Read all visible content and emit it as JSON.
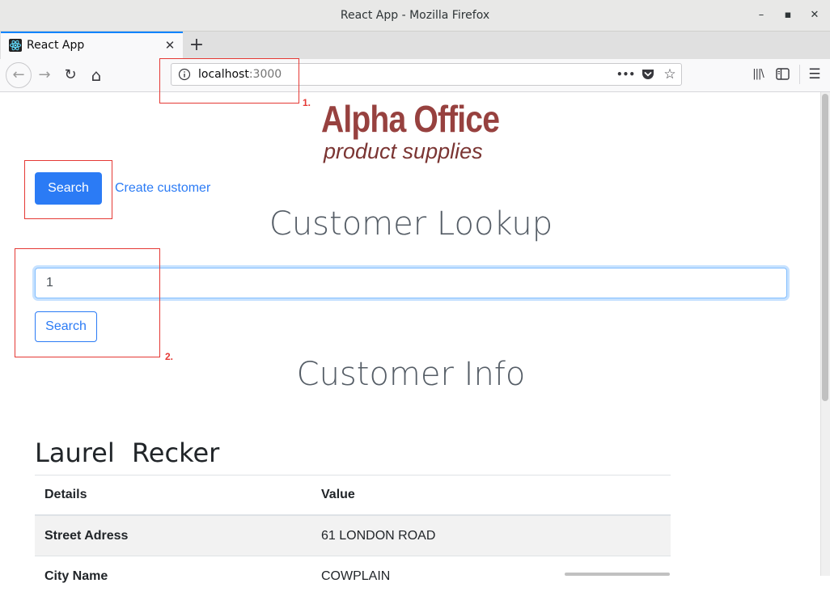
{
  "window": {
    "title": "React App - Mozilla Firefox",
    "controls": {
      "minimize": "–",
      "maximize": "▪",
      "close": "✕"
    }
  },
  "tabs": [
    {
      "title": "React App",
      "icon": "react-logo-icon",
      "active": true
    }
  ],
  "toolbar": {
    "new_tab": "+",
    "back": "←",
    "forward": "→",
    "reload": "↻",
    "home": "⌂",
    "page_actions": "•••",
    "library": "|||\\",
    "sidebar": "▥",
    "menu": "☰"
  },
  "url": {
    "host": "localhost",
    "port": ":3000"
  },
  "annotations": [
    {
      "label": "1."
    },
    {
      "label": "2."
    }
  ],
  "page": {
    "logo": {
      "line1": "Alpha Office",
      "line2": "product supplies"
    },
    "nav": {
      "search_label": "Search",
      "create_label": "Create customer"
    },
    "lookup": {
      "heading": "Customer Lookup",
      "input_value": "1",
      "button_label": "Search"
    },
    "info": {
      "heading": "Customer Info",
      "first_name": "Laurel",
      "last_name": "Recker",
      "table": {
        "headers": [
          "Details",
          "Value"
        ],
        "rows": [
          {
            "key": "Street Adress",
            "value": "61 LONDON ROAD"
          },
          {
            "key": "City Name",
            "value": "COWPLAIN"
          }
        ]
      }
    }
  },
  "colors": {
    "primary": "#2b7bf5",
    "logo": "#97413f",
    "annotation": "#e53935",
    "tab_accent": "#0a84ff"
  }
}
